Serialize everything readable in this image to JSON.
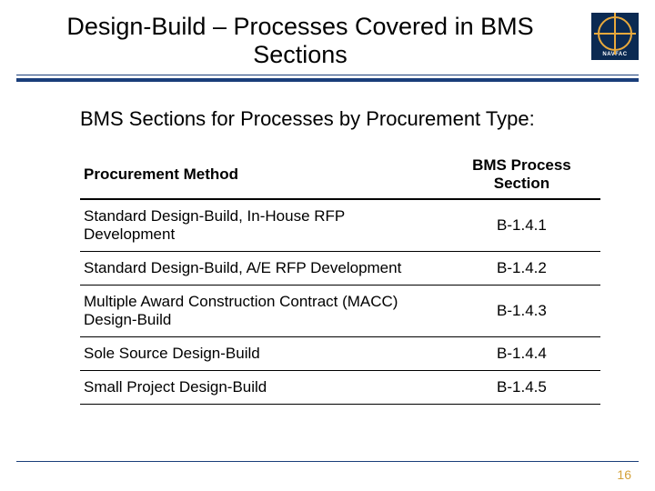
{
  "header": {
    "title": "Design-Build – Processes Covered in BMS Sections",
    "logo_label": "NAVFAC"
  },
  "subtitle": "BMS Sections for Processes by Procurement Type:",
  "table": {
    "headers": {
      "method": "Procurement Method",
      "section": "BMS Process Section"
    },
    "rows": [
      {
        "method": "Standard Design-Build, In-House RFP Development",
        "section": "B-1.4.1"
      },
      {
        "method": "Standard Design-Build, A/E RFP Development",
        "section": "B-1.4.2"
      },
      {
        "method": "Multiple Award Construction Contract (MACC) Design-Build",
        "section": "B-1.4.3"
      },
      {
        "method": "Sole Source Design-Build",
        "section": "B-1.4.4"
      },
      {
        "method": "Small Project Design-Build",
        "section": "B-1.4.5"
      }
    ]
  },
  "page_number": "16"
}
